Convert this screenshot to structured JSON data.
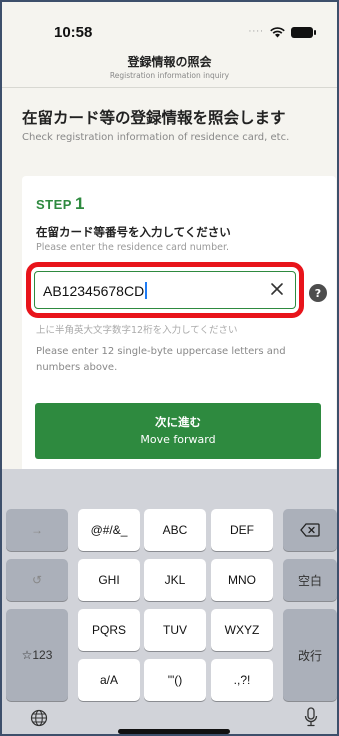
{
  "status": {
    "time": "10:58"
  },
  "nav": {
    "title": "登録情報の照会",
    "subtitle": "Registration information inquiry"
  },
  "page": {
    "heading": "在留カード等の登録情報を照会します",
    "subheading": "Check registration information of residence card, etc."
  },
  "step": {
    "word": "STEP",
    "number": "1",
    "instruction_jp": "在留カード等番号を入力してください",
    "instruction_en": "Please enter the residence card number."
  },
  "input": {
    "value": "AB12345678CD",
    "hint_jp": "上に半角英大文字数字12桁を入力してください",
    "hint_en": "Please enter 12 single-byte uppercase letters and numbers above."
  },
  "help": {
    "label": "?"
  },
  "next_button": {
    "label_jp": "次に進む",
    "label_en": "Move forward"
  },
  "keyboard": {
    "rows": [
      [
        "→",
        "@#/&_",
        "ABC",
        "DEF",
        "⌫"
      ],
      [
        "↺",
        "GHI",
        "JKL",
        "MNO",
        "空白"
      ],
      [
        "☆123",
        "PQRS",
        "TUV",
        "WXYZ",
        "改行"
      ],
      [
        "a/A",
        "'\"()",
        ".,?!"
      ]
    ],
    "key_tap": "→",
    "key_symbols": "@#/&_",
    "key_abc": "ABC",
    "key_def": "DEF",
    "key_delete": "⌫",
    "key_undo": "↺",
    "key_ghi": "GHI",
    "key_jkl": "JKL",
    "key_mno": "MNO",
    "key_space": "空白",
    "key_num": "☆123",
    "key_pqrs": "PQRS",
    "key_tuv": "TUV",
    "key_wxyz": "WXYZ",
    "key_return": "改行",
    "key_case": "a/A",
    "key_quotes": "'\"()",
    "key_punct": ".,?!"
  },
  "icons": [
    "globe-icon",
    "microphone-icon",
    "wifi-icon",
    "battery-icon",
    "clear-icon"
  ],
  "colors": {
    "accent_green": "#2e8a3f",
    "highlight_red": "#e8141b",
    "background": "#f5f4ef"
  }
}
